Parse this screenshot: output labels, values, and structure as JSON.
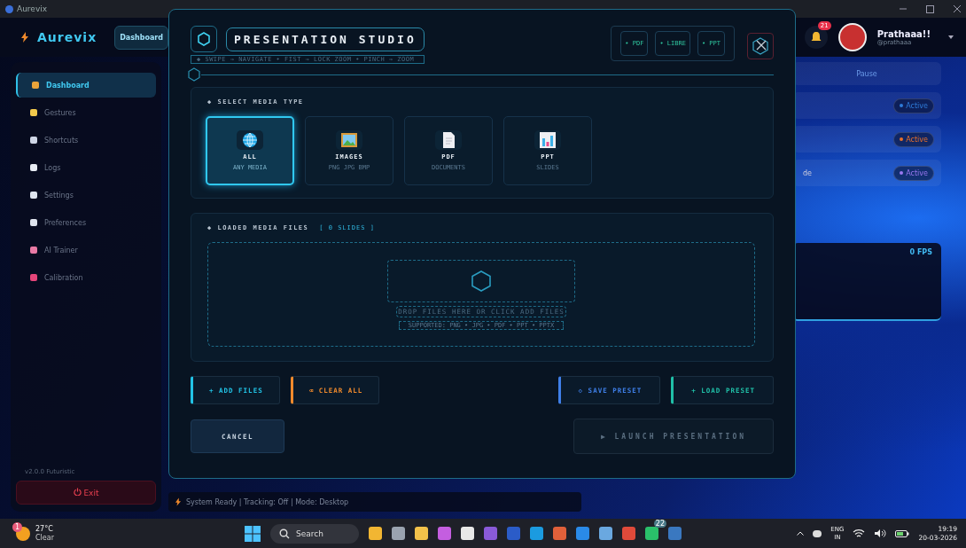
{
  "window": {
    "title": "Aurevix"
  },
  "header": {
    "logo": "Aurevix",
    "tab": "Dashboard",
    "notifications": "21",
    "user_name": "Prathaaa!!",
    "user_handle": "@prathaaa"
  },
  "sidebar": {
    "items": [
      {
        "label": "Dashboard",
        "selected": true,
        "color": "#e8a33a"
      },
      {
        "label": "Gestures",
        "selected": false,
        "color": "#f2c94c"
      },
      {
        "label": "Shortcuts",
        "selected": false,
        "color": "#cfd6e6"
      },
      {
        "label": "Logs",
        "selected": false,
        "color": "#e8ecf4"
      },
      {
        "label": "Settings",
        "selected": false,
        "color": "#dfe4ee"
      },
      {
        "label": "Preferences",
        "selected": false,
        "color": "#dfe4ee"
      },
      {
        "label": "AI Trainer",
        "selected": false,
        "color": "#e97aa5"
      },
      {
        "label": "Calibration",
        "selected": false,
        "color": "#e5457a"
      }
    ],
    "version": "v2.0.0 Futuristic",
    "exit": "Exit"
  },
  "background_panel": {
    "pause": "Pause",
    "fragment": "de",
    "fps": "0 FPS",
    "statuses": [
      {
        "label": "Active",
        "color": "#2e7bd9"
      },
      {
        "label": "Active",
        "color": "#e8702a"
      },
      {
        "label": "Active",
        "color": "#9a78f0"
      }
    ]
  },
  "status_bar": "System Ready | Tracking: Off | Mode: Desktop",
  "modal": {
    "title": "PRESENTATION STUDIO",
    "hint": "◆ SWIPE → NAVIGATE • FIST → LOCK ZOOM • PINCH → ZOOM",
    "formats": [
      "• PDF",
      "• LIBRE",
      "• PPT"
    ],
    "media_section": "◆ SELECT MEDIA TYPE",
    "media_types": [
      {
        "kind": "globe",
        "label": "ALL",
        "sublabel": "ANY MEDIA",
        "selected": true
      },
      {
        "kind": "image",
        "label": "IMAGES",
        "sublabel": "PNG JPG BMP",
        "selected": false
      },
      {
        "kind": "document",
        "label": "PDF",
        "sublabel": "DOCUMENTS",
        "selected": false
      },
      {
        "kind": "chart",
        "label": "PPT",
        "sublabel": "SLIDES",
        "selected": false
      }
    ],
    "files_section": "◆ LOADED MEDIA FILES",
    "slide_count": "[ 0 SLIDES ]",
    "drop_text": "DROP FILES HERE OR CLICK ADD FILES",
    "supported": "SUPPORTED: PNG • JPG • PDF • PPT • PPTX",
    "actions": [
      {
        "label": "+ ADD FILES",
        "color": "#22c3e6"
      },
      {
        "label": "⌫ CLEAR ALL",
        "color": "#f08a2c"
      }
    ],
    "presets": [
      {
        "label": "◇ SAVE PRESET",
        "color": "#3f7fe8"
      },
      {
        "label": "+ LOAD PRESET",
        "color": "#20c0a8"
      }
    ],
    "cancel": "CANCEL",
    "launch": {
      "label": "▶ LAUNCH PRESENTATION",
      "disabled": true
    }
  },
  "taskbar": {
    "temperature": "27°C",
    "weather": "Clear",
    "weather_badge": "1",
    "search": "Search",
    "apps": [
      {
        "color": "#f2b632"
      },
      {
        "color": "#9aa3b0"
      },
      {
        "color": "#f2c14a"
      },
      {
        "color": "#c45ee0"
      },
      {
        "color": "#e8e8e8"
      },
      {
        "color": "#8a5ad8"
      },
      {
        "color": "#2b5cc8"
      },
      {
        "color": "#1b9be0"
      },
      {
        "color": "#e0603a"
      },
      {
        "color": "#2a8ae8"
      },
      {
        "color": "#6aa8e0"
      },
      {
        "color": "#e04a3a"
      },
      {
        "color": "#2ac06a",
        "badge": "22"
      },
      {
        "color": "#3a78c0"
      }
    ],
    "language": "ENG",
    "region": "IN",
    "time": "19:19",
    "date": "20-03-2026"
  }
}
